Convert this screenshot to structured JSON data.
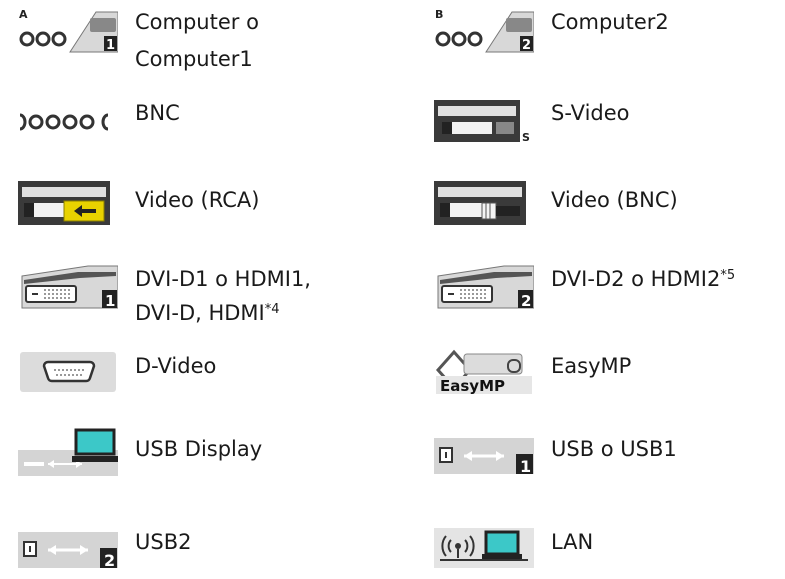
{
  "sources": {
    "computer1": {
      "line1": "Computer o",
      "line2": "Computer1"
    },
    "computer2": {
      "label": "Computer2"
    },
    "bnc": {
      "label": "BNC"
    },
    "svideo": {
      "label": "S-Video"
    },
    "video_rca": {
      "label": "Video (RCA)"
    },
    "video_bnc": {
      "label": "Video (BNC)"
    },
    "dvi1": {
      "line1": "DVI-D1 o HDMI1,",
      "line2": "DVI-D, HDMI",
      "note": "*4"
    },
    "dvi2": {
      "label": "DVI-D2 o HDMI2",
      "note": "*5"
    },
    "dvideo": {
      "label": "D-Video"
    },
    "easymp": {
      "label": "EasyMP",
      "logo_text": "EasyMP"
    },
    "usb_display": {
      "label": "USB Display"
    },
    "usb1": {
      "label": "USB o USB1"
    },
    "usb2": {
      "label": "USB2"
    },
    "lan": {
      "label": "LAN"
    }
  },
  "icon_badges": {
    "computer1_letter": "A",
    "computer1_num": "1",
    "computer2_letter": "B",
    "computer2_num": "2",
    "svideo_letter": "S",
    "dvi1_num": "1",
    "dvi2_num": "2",
    "usb1_num": "1",
    "usb2_num": "2"
  },
  "colors": {
    "icon_dark": "#2a2a2a",
    "icon_gray": "#b0b0b0",
    "video_yellow": "#e8d200",
    "lan_cyan": "#3cc8c8"
  }
}
